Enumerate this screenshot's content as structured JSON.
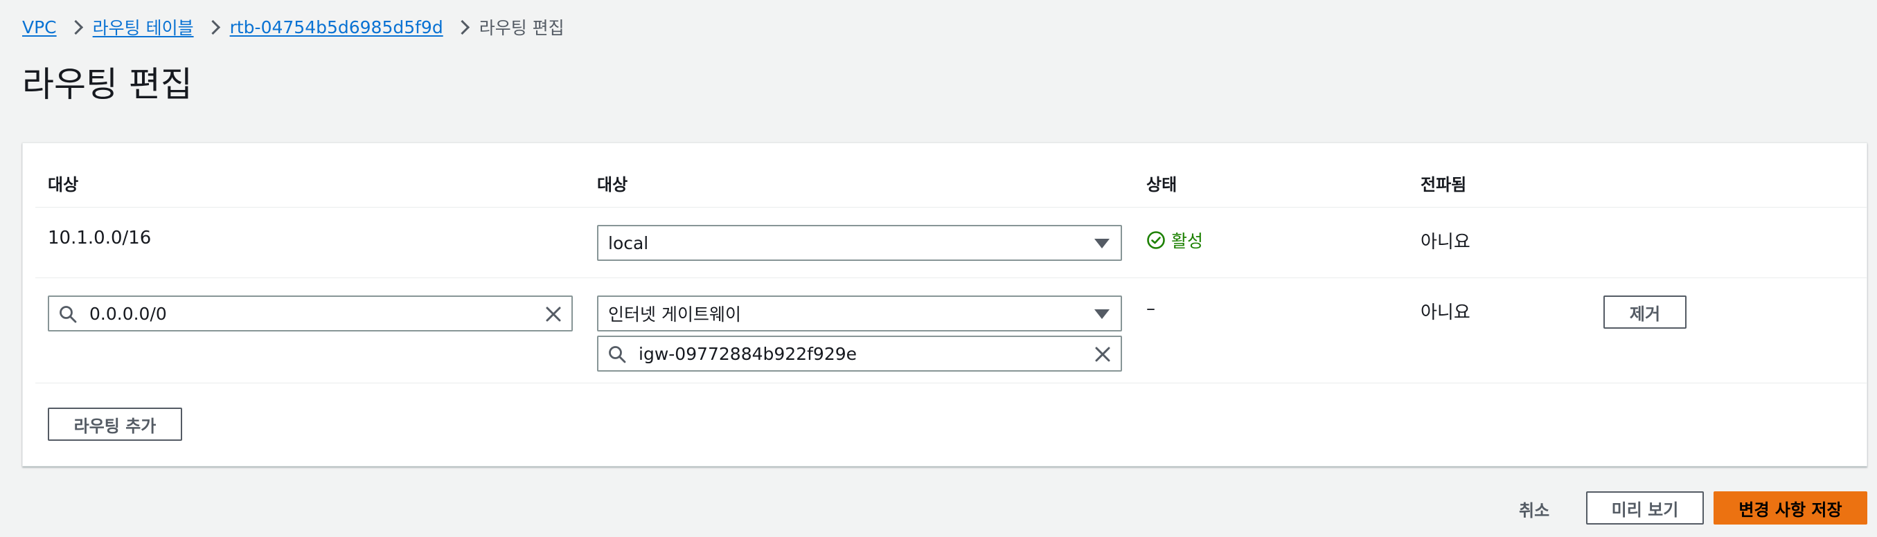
{
  "breadcrumb": {
    "items": [
      "VPC",
      "라우팅 테이블",
      "rtb-04754b5d6985d5f9d"
    ],
    "current": "라우팅 편집"
  },
  "page_title": "라우팅 편집",
  "table": {
    "headers": [
      "대상",
      "대상",
      "상태",
      "전파됨"
    ],
    "rows": [
      {
        "destination": "10.1.0.0/16",
        "target_select": "local",
        "status": "활성",
        "propagated": "아니요"
      },
      {
        "destination_input": "0.0.0.0/0",
        "target_select": "인터넷 게이트웨이",
        "target_id_input": "igw-09772884b922f929e",
        "status": "–",
        "propagated": "아니요",
        "remove_label": "제거"
      }
    ],
    "add_route_label": "라우팅 추가"
  },
  "footer": {
    "cancel_label": "취소",
    "preview_label": "미리 보기",
    "save_label": "변경 사항 저장"
  },
  "colors": {
    "link": "#0972d3",
    "success": "#1d8102",
    "primary": "#ec7211"
  }
}
